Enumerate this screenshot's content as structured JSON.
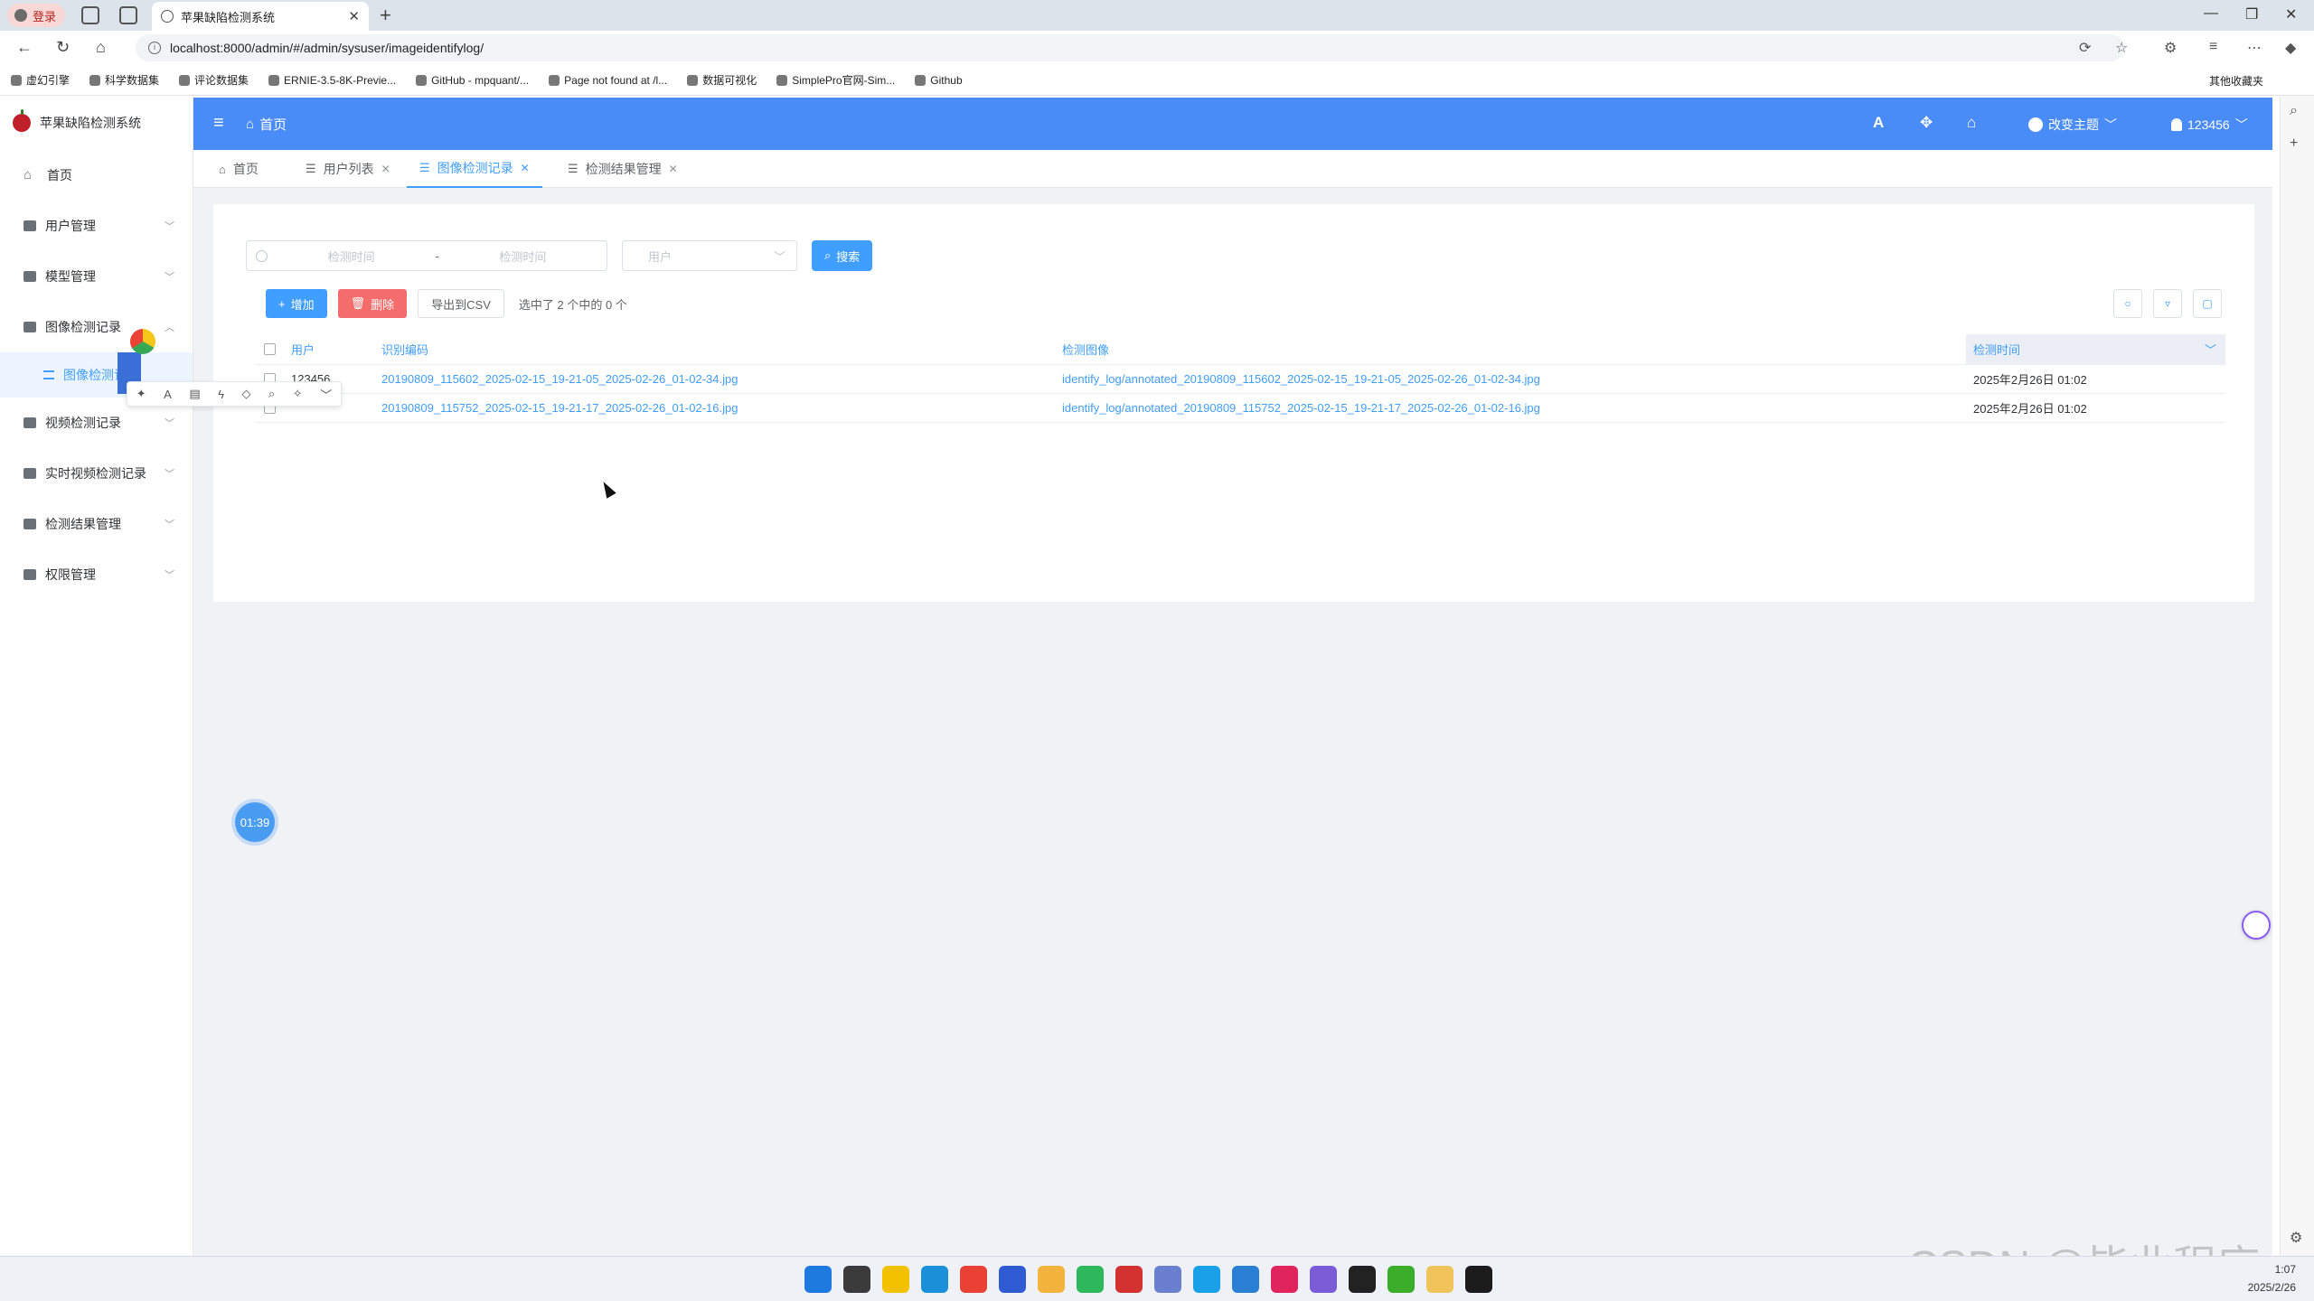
{
  "browser": {
    "profile_label": "登录",
    "tab_title": "苹果缺陷检测系统",
    "url": "localhost:8000/admin/#/admin/sysuser/imageidentifylog/",
    "bookmarks": [
      "虚幻引擎",
      "科学数据集",
      "评论数据集",
      "ERNIE-3.5-8K-Previe...",
      "GitHub - mpquant/...",
      "Page not found at /l...",
      "数据可视化",
      "SimplePro官网-Sim...",
      "Github"
    ],
    "other_bookmarks": "其他收藏夹"
  },
  "app": {
    "title": "苹果缺陷检测系统",
    "header_home": "首页",
    "theme_label": "改变主题",
    "username": "123456"
  },
  "sidebar": {
    "items": [
      {
        "label": "首页"
      },
      {
        "label": "用户管理"
      },
      {
        "label": "模型管理"
      },
      {
        "label": "图像检测记录"
      },
      {
        "label": "视频检测记录"
      },
      {
        "label": "实时视频检测记录"
      },
      {
        "label": "检测结果管理"
      },
      {
        "label": "权限管理"
      }
    ],
    "sub_item": "图像检测记录"
  },
  "tags": [
    {
      "label": "首页"
    },
    {
      "label": "用户列表"
    },
    {
      "label": "图像检测记录"
    },
    {
      "label": "检测结果管理"
    }
  ],
  "search": {
    "start_placeholder": "检测时间",
    "end_placeholder": "检测时间",
    "range_separator": "-",
    "user_placeholder": "用户",
    "search_label": "搜索"
  },
  "toolbar": {
    "add_label": "增加",
    "delete_label": "删除",
    "export_label": "导出到CSV",
    "selected_text": "选中了 2 个中的 0 个"
  },
  "table": {
    "headers": {
      "user": "用户",
      "code": "识别编码",
      "image": "检测图像",
      "time": "检测时间"
    },
    "rows": [
      {
        "user": "123456",
        "code": "20190809_115602_2025-02-15_19-21-05_2025-02-26_01-02-34.jpg",
        "image": "identify_log/annotated_20190809_115602_2025-02-15_19-21-05_2025-02-26_01-02-34.jpg",
        "time": "2025年2月26日 01:02"
      },
      {
        "user": "",
        "code": "20190809_115752_2025-02-15_19-21-17_2025-02-26_01-02-16.jpg",
        "image": "identify_log/annotated_20190809_115752_2025-02-15_19-21-17_2025-02-26_01-02-16.jpg",
        "time": "2025年2月26日 01:02"
      }
    ]
  },
  "timer": "01:39",
  "watermark": "CSDN @毕业程序",
  "tray": {
    "time": "1:07",
    "date": "2025/2/26"
  },
  "colors": {
    "header": "#4a8cf7",
    "primary": "#409eff",
    "danger": "#f56c6c",
    "content_bg": "#f0f2f5"
  }
}
